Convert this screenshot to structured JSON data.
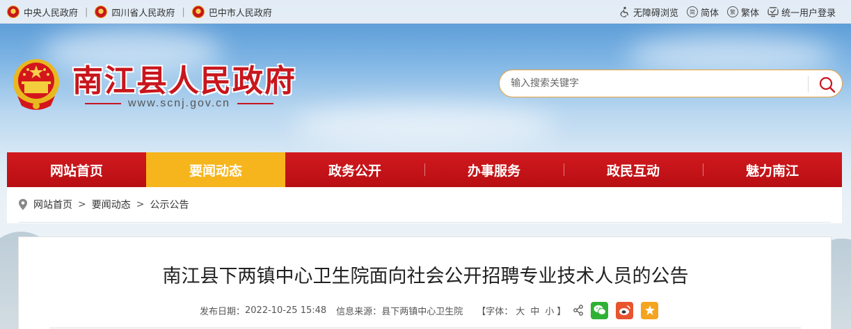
{
  "topbar": {
    "links": [
      {
        "label": "中央人民政府"
      },
      {
        "label": "四川省人民政府"
      },
      {
        "label": "巴中市人民政府"
      }
    ],
    "tools": {
      "accessible": "无障碍浏览",
      "simplified_icon": "简",
      "simplified": "简体",
      "traditional_icon": "繁",
      "traditional": "繁体",
      "login": "统一用户登录"
    }
  },
  "header": {
    "site_title": "南江县人民政府",
    "site_url": "www.scnj.gov.cn"
  },
  "search": {
    "placeholder": "输入搜索关键字"
  },
  "nav": {
    "items": [
      {
        "label": "网站首页"
      },
      {
        "label": "要闻动态"
      },
      {
        "label": "政务公开"
      },
      {
        "label": "办事服务"
      },
      {
        "label": "政民互动"
      },
      {
        "label": "魅力南江"
      }
    ],
    "active": "要闻动态"
  },
  "breadcrumb": {
    "items": [
      "网站首页",
      "要闻动态",
      "公示公告"
    ],
    "separator": ">"
  },
  "article": {
    "title": "南江县下两镇中心卫生院面向社会公开招聘专业技术人员的公告",
    "date_label": "发布日期：",
    "date": "2022-10-25 15:48",
    "source_label": "信息来源：",
    "source": "县下两镇中心卫生院",
    "font_open": "【字体：",
    "font_large": "大",
    "font_medium": "中",
    "font_small": "小",
    "font_close": "】"
  },
  "colors": {
    "brand_red": "#c8161d",
    "nav_active": "#f6b51c",
    "search_border": "#e8a33a"
  },
  "icons": [
    "national-emblem-icon",
    "accessibility-icon",
    "simplified-icon",
    "traditional-icon",
    "login-icon",
    "search-icon",
    "location-pin-icon",
    "share-icon",
    "wechat-icon",
    "weibo-icon",
    "favorite-icon"
  ]
}
